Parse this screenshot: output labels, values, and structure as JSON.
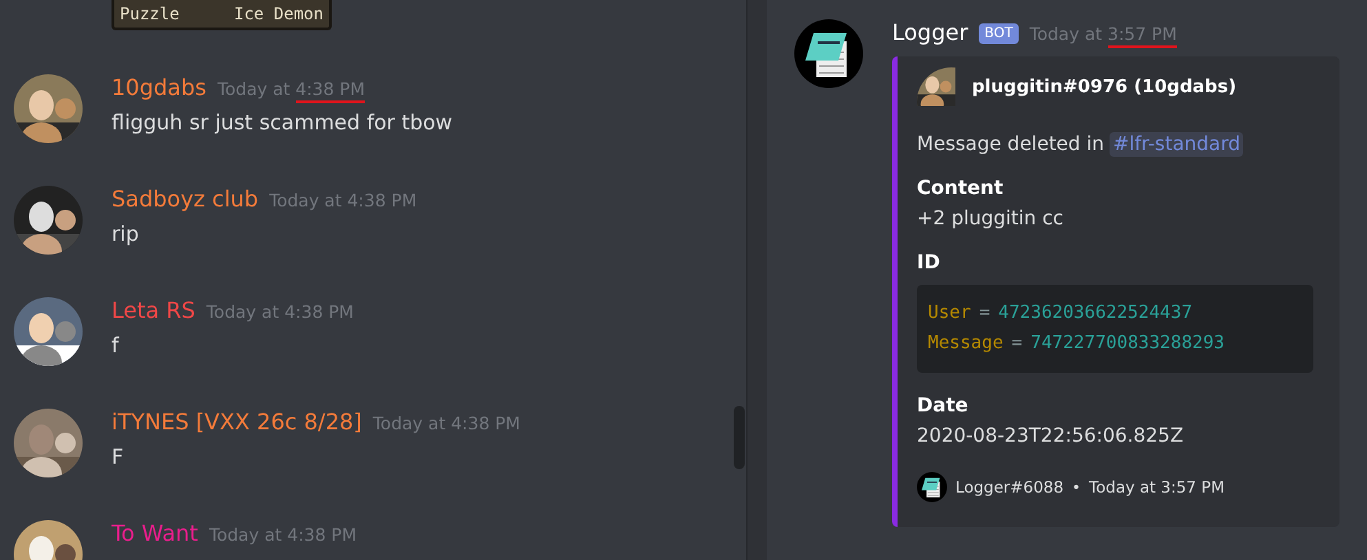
{
  "left_chat": {
    "attachment": {
      "labels": [
        "Puzzle",
        "Ice Demon"
      ]
    },
    "messages": [
      {
        "author": "10gdabs",
        "color": "#f47b3a",
        "timestamp_prefix": "Today at ",
        "time": "4:38 PM",
        "underlined": true,
        "text": "fligguh sr just scammed for tbow"
      },
      {
        "author": "Sadboyz club",
        "color": "#f47b3a",
        "timestamp_prefix": "Today at ",
        "time": "4:38 PM",
        "underlined": false,
        "text": "rip"
      },
      {
        "author": "Leta RS",
        "color": "#f04747",
        "timestamp_prefix": "Today at ",
        "time": "4:38 PM",
        "underlined": false,
        "text": "f"
      },
      {
        "author": "iTYNES [VXX 26c 8/28]",
        "color": "#f47b3a",
        "timestamp_prefix": "Today at ",
        "time": "4:38 PM",
        "underlined": false,
        "text": "F"
      },
      {
        "author": "To Want",
        "color": "#e91e8c",
        "timestamp_prefix": "Today at ",
        "time": "4:38 PM",
        "underlined": false
      }
    ]
  },
  "right_chat": {
    "message": {
      "author": "Logger",
      "badge": "BOT",
      "timestamp_prefix": "Today at ",
      "time": "3:57 PM",
      "underlined": true,
      "embed": {
        "color": "#8a2be2",
        "author": "pluggitin#0976 (10gdabs)",
        "description": "Message deleted in ",
        "channel": "#lfr-standard",
        "fields": [
          {
            "kind": "text",
            "name": "Content",
            "value": "+2 pluggitin cc"
          },
          {
            "kind": "code",
            "name": "ID",
            "lines": [
              {
                "key": "User",
                "op": "=",
                "value": "472362036622524437"
              },
              {
                "key": "Message",
                "op": "=",
                "value": "747227700833288293"
              }
            ]
          },
          {
            "kind": "text",
            "name": "Date",
            "value": "2020-08-23T22:56:06.825Z"
          }
        ],
        "footer": {
          "name": "Logger#6088",
          "separator": "•",
          "time": "Today at 3:57 PM"
        }
      }
    }
  }
}
